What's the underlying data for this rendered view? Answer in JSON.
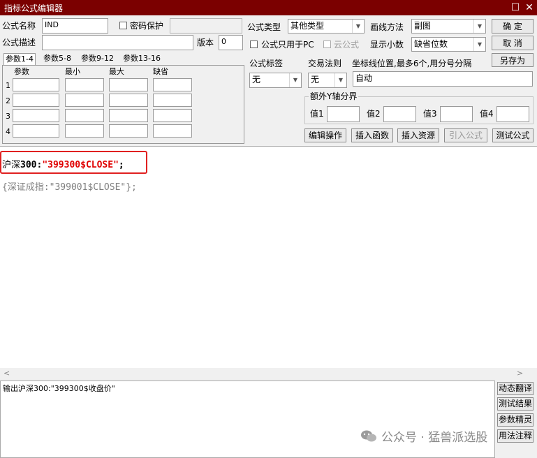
{
  "window": {
    "title": "指标公式编辑器",
    "restore_glyph": "☐",
    "close_glyph": "✕"
  },
  "top_form": {
    "name_label": "公式名称",
    "name_value": "IND",
    "password_label": "密码保护",
    "desc_label": "公式描述",
    "desc_value": "",
    "version_label": "版本",
    "version_value": "0",
    "type_label": "公式类型",
    "type_value": "其他类型",
    "draw_label": "画线方法",
    "draw_value": "副图",
    "pc_only_label": "公式只用于PC",
    "cloud_label": "云公式",
    "decimal_label": "显示小数",
    "decimal_value": "缺省位数",
    "tag_label": "公式标签",
    "tag_value": "无",
    "trade_label": "交易法则",
    "trade_value": "无",
    "coord_label": "坐标线位置,最多6个,用分号分隔",
    "coord_value": "自动"
  },
  "buttons": {
    "ok": "确  定",
    "cancel": "取  消",
    "save_as": "另存为"
  },
  "param_tabs": [
    "参数1-4",
    "参数5-8",
    "参数9-12",
    "参数13-16"
  ],
  "param_headers": [
    "参数",
    "最小",
    "最大",
    "缺省"
  ],
  "param_rows": [
    "1",
    "2",
    "3",
    "4"
  ],
  "yaxis": {
    "title": "额外Y轴分界",
    "labels": [
      "值1",
      "值2",
      "值3",
      "值4"
    ]
  },
  "editor_toolbar": [
    "编辑操作",
    "插入函数",
    "插入资源",
    "引入公式",
    "测试公式"
  ],
  "code": {
    "line1_name": "沪深",
    "line1_num": "300",
    "line1_colon": ":",
    "line1_string": "\"399300$CLOSE\"",
    "line1_semi": ";",
    "line2": "{深证成指:\"399001$CLOSE\"};"
  },
  "scroll": {
    "left": "<",
    "right": ">"
  },
  "output": {
    "text": "输出沪深300:\"399300$收盘价\""
  },
  "side_buttons": [
    "动态翻译",
    "测试结果",
    "参数精灵",
    "用法注释"
  ],
  "watermark": "公众号 · 猛兽派选股"
}
